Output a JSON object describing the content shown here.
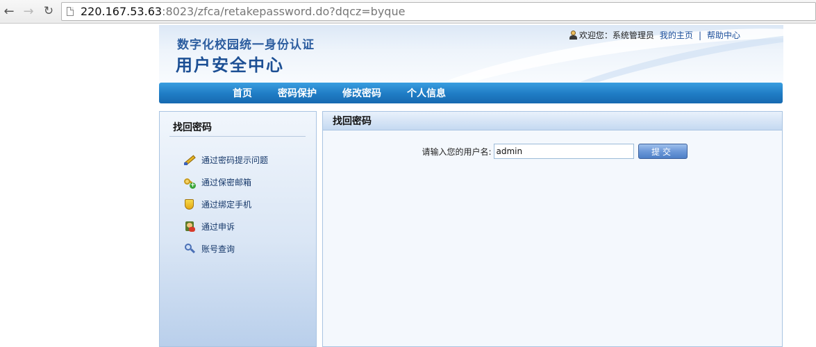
{
  "browser": {
    "url_host": "220.167.53.63",
    "url_rest": ":8023/zfca/retakepassword.do?dqcz=byque"
  },
  "header": {
    "subtitle": "数字化校园统一身份认证",
    "title": "用户安全中心",
    "welcome": "欢迎您：系统管理员",
    "my_home_link": "我的主页",
    "separator": "|",
    "help_link": "帮助中心"
  },
  "navbar": {
    "items": [
      {
        "label": "首页"
      },
      {
        "label": "密码保护"
      },
      {
        "label": "修改密码"
      },
      {
        "label": "个人信息"
      }
    ]
  },
  "sidebar": {
    "title": "找回密码",
    "items": [
      {
        "label": "通过密码提示问题",
        "icon": "pencil-icon"
      },
      {
        "label": "通过保密邮箱",
        "icon": "key-add-icon"
      },
      {
        "label": "通过绑定手机",
        "icon": "shield-icon"
      },
      {
        "label": "通过申诉",
        "icon": "person-icon"
      },
      {
        "label": "账号查询",
        "icon": "magnifier-icon"
      }
    ]
  },
  "main": {
    "title": "找回密码",
    "form": {
      "label": "请输入您的用户名:",
      "username_value": "admin",
      "submit_label": "提交"
    }
  },
  "colors": {
    "navbar": "#1f7cc4",
    "title_blue": "#1c4f94",
    "link_blue": "#1a4d9a"
  }
}
